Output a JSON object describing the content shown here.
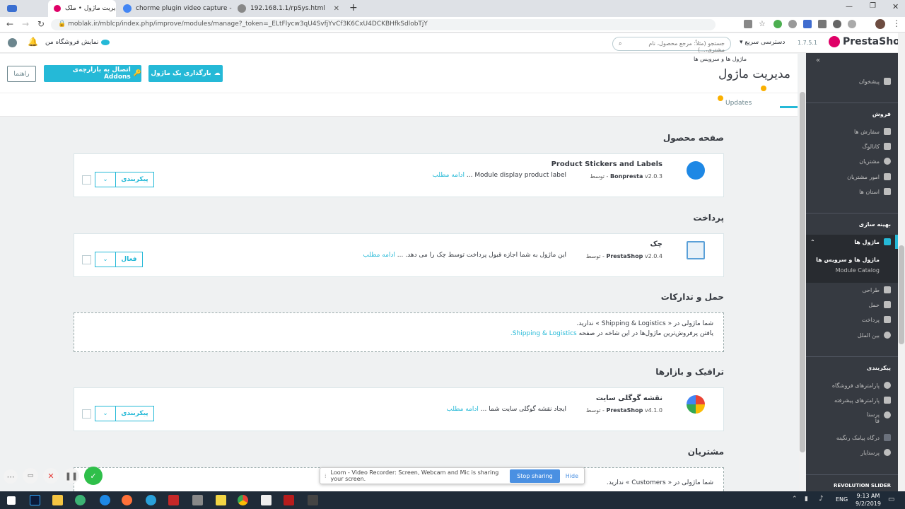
{
  "browser": {
    "tabs": [
      {
        "title": "مدیریت ماژول • ملک",
        "active": true
      },
      {
        "title": "chorme plugin video capture - G",
        "active": false
      },
      {
        "title": "192.168.1.1/rpSys.html",
        "active": false
      }
    ],
    "new_tab": "+",
    "url": "moblak.ir/mblcp/index.php/improve/modules/manage?_token=_ELtFlycw3qU4SvfjYvCf3K6CxU4DCKBHfkSdlobTjY"
  },
  "header": {
    "logo": "PrestaShop",
    "version": "1.7.5.1",
    "quick_access": "دسترسی سریع",
    "search_placeholder": "جستجو (مثلاً: مرجع محصول، نام مشتری،...)",
    "view_shop": "نمایش فروشگاه من"
  },
  "toolbar": {
    "breadcrumb": "ماژول ها و سرویس ها",
    "page_title": "مدیریت ماژول",
    "upload_btn": "بارگذاری یک ماژول",
    "addons_btn": "اتصال به بازارچه‌ی Addons",
    "help_btn": "راهنما",
    "tab_updates": "Updates"
  },
  "sidebar": {
    "dashboard": "پیشخوان",
    "sell_title": "فروش",
    "sell_items": [
      "سفارش ها",
      "کاتالوگ",
      "مشتریان",
      "امور مشتریان",
      "استان ها"
    ],
    "improve_title": "بهینه سازی",
    "modules": "ماژول ها",
    "modules_sub": [
      "ماژول ها و سرویس ها",
      "Module Catalog"
    ],
    "improve_items": [
      "طراحی",
      "حمل",
      "پرداخت",
      "بین الملل"
    ],
    "config_title": "پیکربندی",
    "config_items": [
      "پارامترهای فروشگاه",
      "پارامترهای پیشرفته",
      "پرستا",
      "فا",
      "درگاه پیامک رنگینه",
      "پرستایار"
    ],
    "revolution": "REVOLUTION SLIDER"
  },
  "sections": {
    "product_page": "صفحه محصول",
    "payment": "پرداخت",
    "shipping": "حمل و تدارکات",
    "traffic": "ترافیک و بازارها",
    "customers": "مشتریان"
  },
  "modules": [
    {
      "name": "Product Stickers and Labels",
      "version": "v2.0.3 - توسط",
      "author": "Bonpresta",
      "desc": "Module display product label ...",
      "more": "ادامه مطلب",
      "action": "پیکربندی"
    },
    {
      "name": "چک",
      "version": "v2.0.4 - توسط",
      "author": "PrestaShop",
      "desc": "این ماژول به شما اجازه قبول پرداخت توسط چک را می دهد. ...",
      "more": "ادامه مطلب",
      "action": "فعال"
    },
    {
      "name": "نقشه گوگلی سایت",
      "version": "v4.1.0 - توسط",
      "author": "PrestaShop",
      "desc": "ایجاد نقشه گوگلی سایت شما ...",
      "more": "ادامه مطلب",
      "action": "پیکربندی"
    }
  ],
  "shipping_empty": {
    "line1": "شما ماژولی در « Shipping & Logistics » ندارید.",
    "line2": "یافتن پرفروش‌ترین ماژول‌ها در این شاخه در صفحه",
    "link": "Shipping & Logistics."
  },
  "customers_empty": {
    "line1": "شما ماژولی در « Customers » ندارید."
  },
  "loom": {
    "text": "Loom - Video Recorder: Screen, Webcam and Mic is sharing your screen.",
    "stop": "Stop sharing",
    "hide": "Hide"
  },
  "taskbar": {
    "lang": "ENG",
    "time": "9:13 AM",
    "date": "9/2/2019"
  },
  "colors": {
    "accent": "#25b9d7",
    "sidebar": "#363a41",
    "brand_red": "#df0067"
  }
}
